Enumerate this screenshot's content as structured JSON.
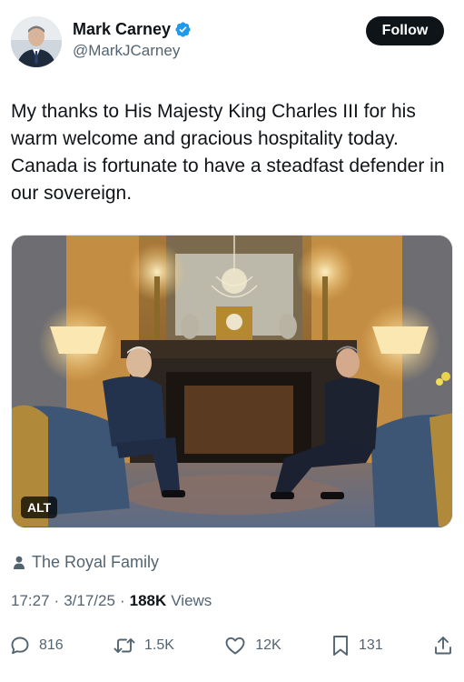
{
  "author": {
    "display_name": "Mark Carney",
    "handle": "@MarkJCarney",
    "verified": true,
    "follow_label": "Follow"
  },
  "tweet": {
    "text": "My thanks to His Majesty King Charles III for his warm welcome and gracious hospitality today. Canada is fortunate to have a steadfast defender in our sovereign.",
    "media_alt_badge": "ALT",
    "attribution": "The Royal Family"
  },
  "meta": {
    "time": "17:27",
    "date": "3/17/25",
    "separator": "·",
    "views_count": "188K",
    "views_label": "Views"
  },
  "actions": {
    "replies": "816",
    "reposts": "1.5K",
    "likes": "12K",
    "bookmarks": "131"
  },
  "colors": {
    "text": "#0f1419",
    "secondary": "#536471",
    "verified_blue": "#1d9bf0",
    "follow_bg": "#0f1419"
  },
  "icons": [
    "verified-badge-icon",
    "person-icon",
    "reply-icon",
    "repost-icon",
    "like-icon",
    "bookmark-icon",
    "share-icon"
  ]
}
